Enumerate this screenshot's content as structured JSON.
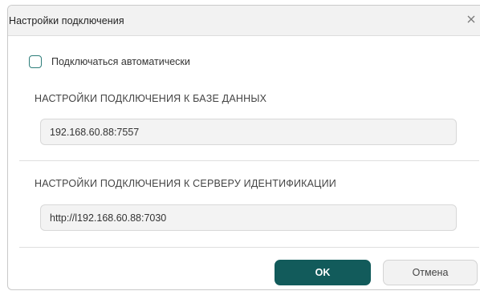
{
  "dialog": {
    "title": "Настройки подключения",
    "close_icon": "close-icon",
    "auto_connect": {
      "label": "Подключаться автоматически",
      "checked": false
    },
    "database_section": {
      "label": "НАСТРОЙКИ ПОДКЛЮЧЕНИЯ К БАЗЕ ДАННЫХ",
      "value": "192.168.60.88:7557"
    },
    "identity_section": {
      "label": "НАСТРОЙКИ ПОДКЛЮЧЕНИЯ К СЕРВЕРУ ИДЕНТИФИКАЦИИ",
      "value": "http://l192.168.60.88:7030"
    },
    "buttons": {
      "ok_label": "OK",
      "cancel_label": "Отмена"
    }
  },
  "colors": {
    "accent": "#125b5b",
    "checkbox_border": "#2d7d7a",
    "field_bg": "#f3f3f3",
    "titlebar_bg": "#f2f2f2"
  }
}
